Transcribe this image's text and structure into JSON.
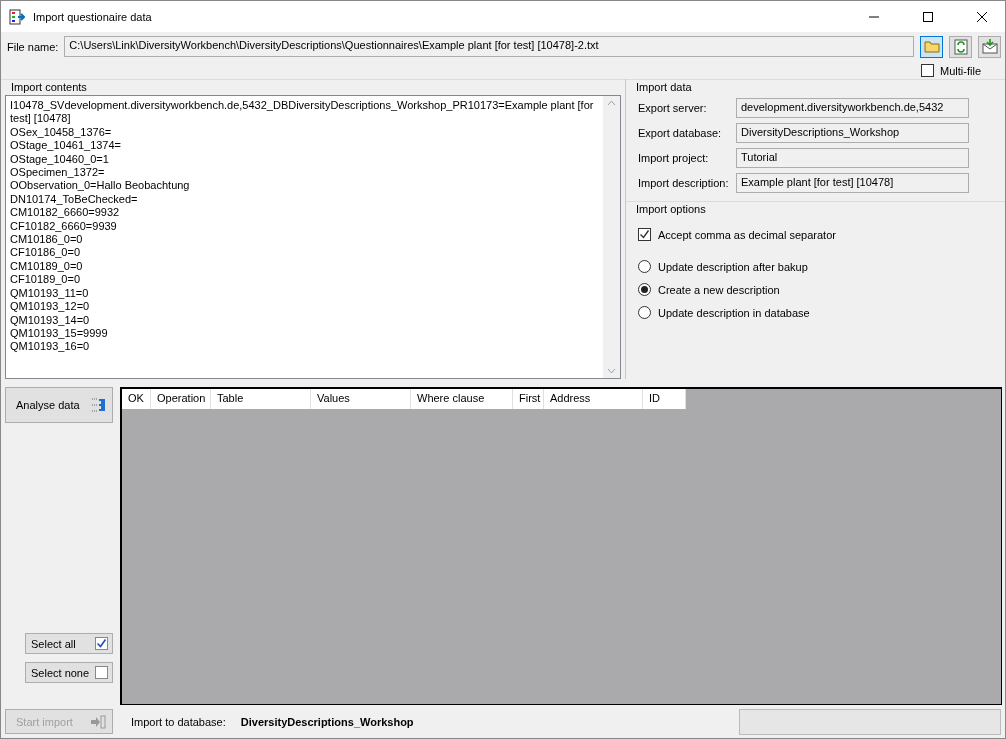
{
  "window": {
    "title": "Import questionaire data"
  },
  "file": {
    "label": "File name:",
    "value": "C:\\Users\\Link\\DiversityWorkbench\\DiversityDescriptions\\Questionnaires\\Example plant [for test] [10478]-2.txt",
    "multi_file": {
      "label": "Multi-file",
      "checked": false
    }
  },
  "import_contents": {
    "title": "Import contents",
    "lines": [
      "I10478_SVdevelopment.diversityworkbench.de,5432_DBDiversityDescriptions_Workshop_PR10173=Example plant [for test] [10478]",
      "OSex_10458_1376=",
      "OStage_10461_1374=",
      "OStage_10460_0=1",
      "OSpecimen_1372=",
      "OObservation_0=Hallo Beobachtung",
      "DN10174_ToBeChecked=",
      "CM10182_6660=9932",
      "CF10182_6660=9939",
      "CM10186_0=0",
      "CF10186_0=0",
      "CM10189_0=0",
      "CF10189_0=0",
      "QM10193_11=0",
      "QM10193_12=0",
      "QM10193_14=0",
      "QM10193_15=9999",
      "QM10193_16=0"
    ]
  },
  "import_data": {
    "title": "Import data",
    "fields": [
      {
        "label": "Export server:",
        "value": "development.diversityworkbench.de,5432"
      },
      {
        "label": "Export database:",
        "value": "DiversityDescriptions_Workshop"
      },
      {
        "label": "Import project:",
        "value": "Tutorial"
      },
      {
        "label": "Import description:",
        "value": "Example plant [for test] [10478]"
      }
    ]
  },
  "import_options": {
    "title": "Import options",
    "checkbox": {
      "label": "Accept comma as decimal separator",
      "checked": true
    },
    "radios": [
      {
        "label": "Update description after bakup",
        "selected": false
      },
      {
        "label": "Create a new description",
        "selected": true
      },
      {
        "label": "Update description in database",
        "selected": false
      }
    ]
  },
  "analyse_button": {
    "label": "Analyse data"
  },
  "select_buttons": [
    {
      "label": "Select all",
      "checked": true
    },
    {
      "label": "Select none",
      "checked": false
    }
  ],
  "table": {
    "columns": [
      "OK",
      "Operation",
      "Table",
      "Values",
      "Where clause",
      "First",
      "Address",
      "ID"
    ]
  },
  "start_button": {
    "label": "Start import",
    "disabled": true
  },
  "status": {
    "label": "Import to database:",
    "value": "DiversityDescriptions_Workshop"
  },
  "progress": {
    "level": 0
  }
}
